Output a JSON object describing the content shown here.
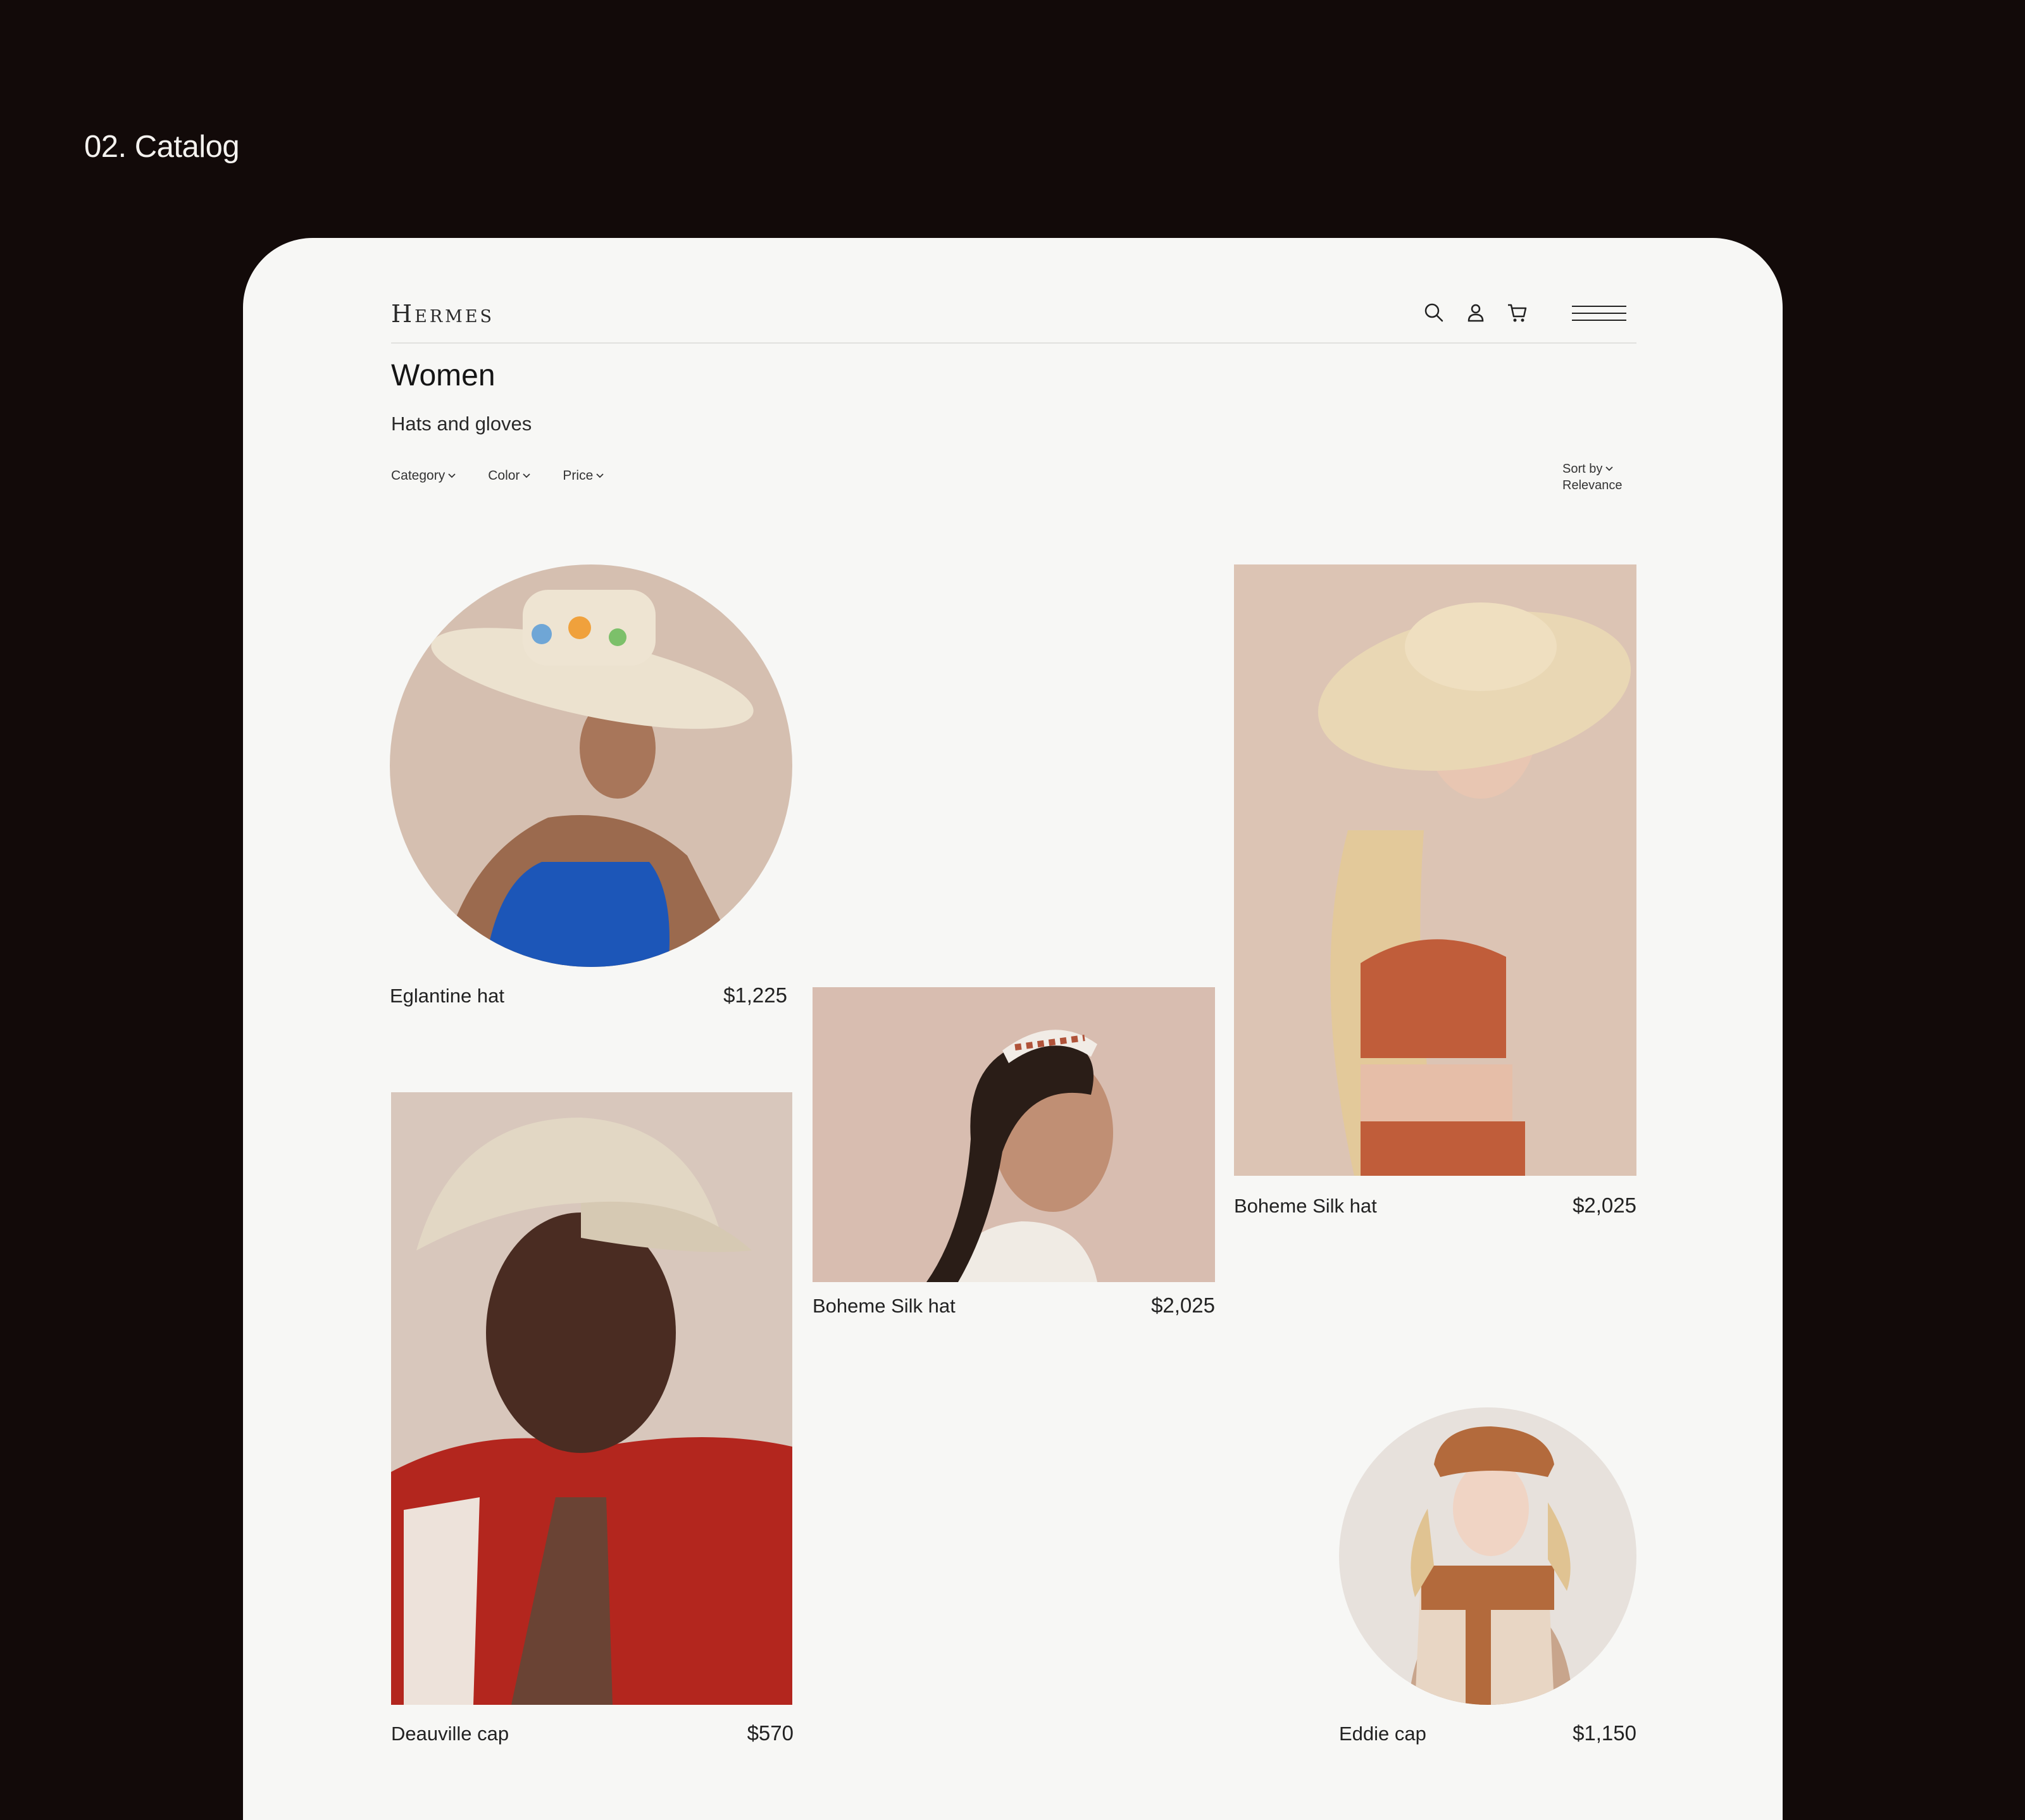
{
  "section": {
    "label": "02. Catalog"
  },
  "header": {
    "logo": "Hermes",
    "icons": [
      "search-icon",
      "user-icon",
      "cart-icon",
      "menu-icon"
    ]
  },
  "page": {
    "title": "Women",
    "subtitle": "Hats and gloves"
  },
  "filters": [
    {
      "label": "Category"
    },
    {
      "label": "Color"
    },
    {
      "label": "Price"
    }
  ],
  "sort": {
    "label": "Sort by",
    "value": "Relevance"
  },
  "products": [
    {
      "name": "Eglantine hat",
      "price": "$1,225"
    },
    {
      "name": "Boheme Silk hat",
      "price": "$2,025"
    },
    {
      "name": "Boheme Silk hat",
      "price": "$2,025"
    },
    {
      "name": "Deauville cap",
      "price": "$570"
    },
    {
      "name": "Eddie cap",
      "price": "$1,150"
    }
  ],
  "colors": {
    "page_background": "#120a09",
    "card_background": "#f7f7f5",
    "photo_background": "#d8c2b4"
  }
}
